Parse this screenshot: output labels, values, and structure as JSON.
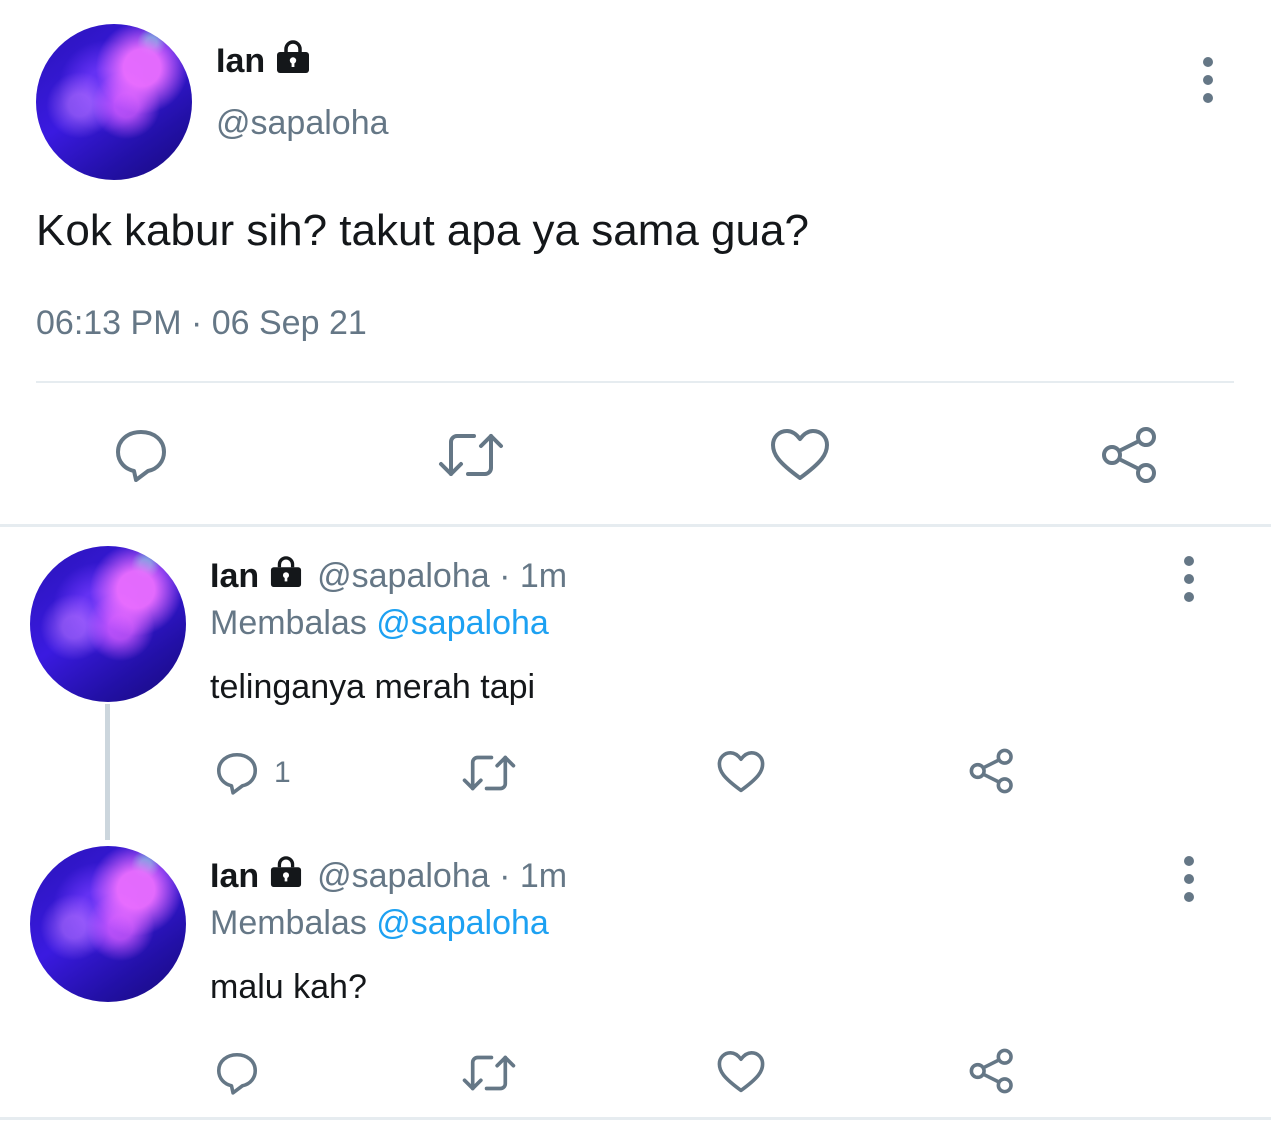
{
  "main_tweet": {
    "author_name": "Ian",
    "handle": "@sapaloha",
    "text": "Kok kabur sih? takut apa ya sama gua?",
    "timestamp": "06:13 PM · 06 Sep 21",
    "icons": [
      "lock-icon",
      "more-options-icon",
      "reply-icon",
      "retweet-icon",
      "like-icon",
      "share-icon"
    ]
  },
  "replies": [
    {
      "author_name": "Ian",
      "handle_time": "@sapaloha · 1m",
      "replying_prefix": "Membalas",
      "replying_to": "@sapaloha",
      "text": "telinganya merah tapi",
      "reply_count": "1"
    },
    {
      "author_name": "Ian",
      "handle_time": "@sapaloha · 1m",
      "replying_prefix": "Membalas",
      "replying_to": "@sapaloha",
      "text": "malu kah?",
      "reply_count": ""
    }
  ],
  "colors": {
    "text_primary": "#14171a",
    "text_secondary": "#657786",
    "mention": "#1da1f2",
    "icon": "#657786",
    "divider": "#e6ecf0",
    "thread_line": "#ccd6dd"
  }
}
